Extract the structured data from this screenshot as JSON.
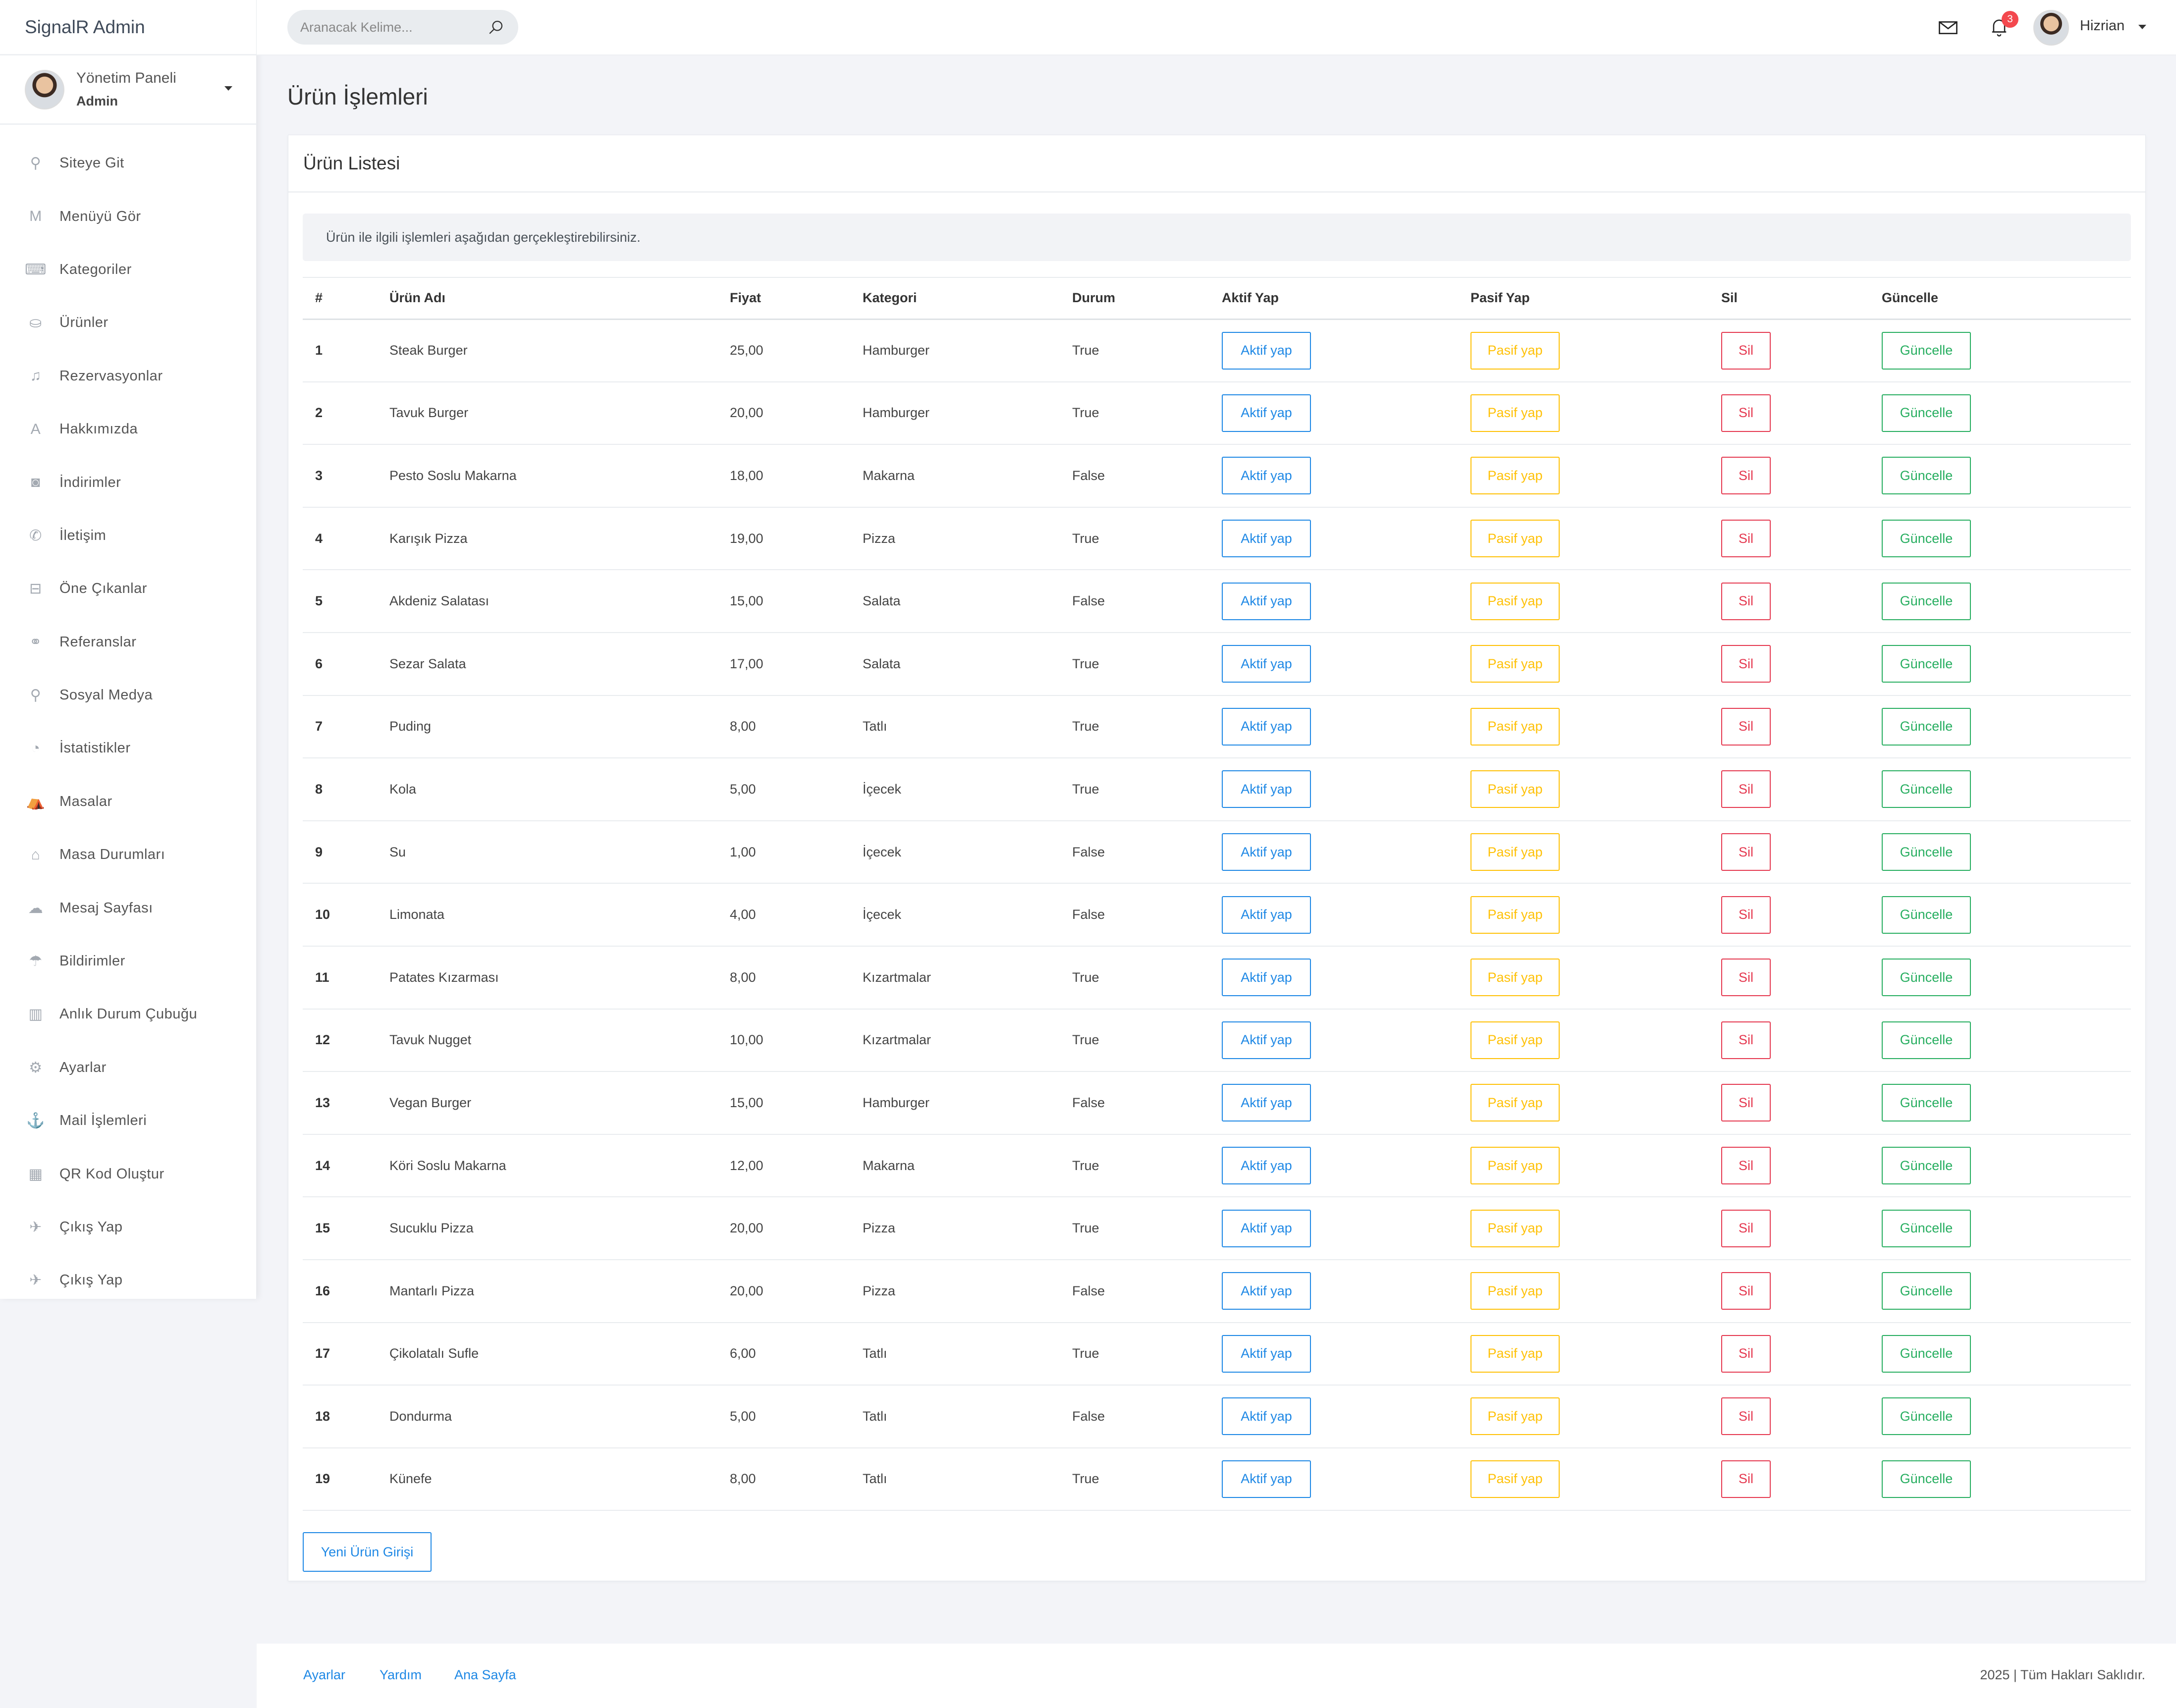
{
  "brand": "SignalR Admin",
  "profile": {
    "title": "Yönetim Paneli",
    "role": "Admin"
  },
  "menu": [
    {
      "label": "Siteye Git",
      "icon": "bicycle-icon"
    },
    {
      "label": "Menüyü Gör",
      "icon": "menu-m-icon"
    },
    {
      "label": "Kategoriler",
      "icon": "keyboard-icon"
    },
    {
      "label": "Ürünler",
      "icon": "cake-icon"
    },
    {
      "label": "Rezervasyonlar",
      "icon": "bell-icon"
    },
    {
      "label": "Hakkımızda",
      "icon": "letter-a-icon"
    },
    {
      "label": "İndirimler",
      "icon": "camera-icon"
    },
    {
      "label": "İletişim",
      "icon": "phone-icon"
    },
    {
      "label": "Öne Çıkanlar",
      "icon": "gamepad-icon"
    },
    {
      "label": "Referanslar",
      "icon": "users-icon"
    },
    {
      "label": "Sosyal Medya",
      "icon": "map-pin-icon"
    },
    {
      "label": "İstatistikler",
      "icon": "pie-chart-icon"
    },
    {
      "label": "Masalar",
      "icon": "tent-icon"
    },
    {
      "label": "Masa Durumları",
      "icon": "house-icon"
    },
    {
      "label": "Mesaj Sayfası",
      "icon": "chat-icon"
    },
    {
      "label": "Bildirimler",
      "icon": "umbrella-icon"
    },
    {
      "label": "Anlık Durum Çubuğu",
      "icon": "bar-chart-icon"
    },
    {
      "label": "Ayarlar",
      "icon": "gear-icon"
    },
    {
      "label": "Mail İşlemleri",
      "icon": "anchor-icon"
    },
    {
      "label": "QR Kod Oluştur",
      "icon": "qr-code-icon"
    },
    {
      "label": "Çıkış Yap",
      "icon": "plane-icon"
    },
    {
      "label": "Çıkış Yap",
      "icon": "plane-icon"
    }
  ],
  "search": {
    "placeholder": "Aranacak Kelime..."
  },
  "topbar": {
    "notification_count": "3",
    "username": "Hizrian"
  },
  "page": {
    "title": "Ürün İşlemleri"
  },
  "card": {
    "title": "Ürün Listesi",
    "info": "Ürün ile ilgili işlemleri aşağıdan gerçekleştirebilirsiniz.",
    "new_button": "Yeni Ürün Girişi"
  },
  "table": {
    "headers": [
      "#",
      "Ürün Adı",
      "Fiyat",
      "Kategori",
      "Durum",
      "Aktif Yap",
      "Pasif Yap",
      "Sil",
      "Güncelle"
    ],
    "button_labels": {
      "aktif": "Aktif yap",
      "pasif": "Pasif yap",
      "sil": "Sil",
      "guncelle": "Güncelle"
    },
    "rows": [
      [
        "1",
        "Steak Burger",
        "25,00",
        "Hamburger",
        "True"
      ],
      [
        "2",
        "Tavuk Burger",
        "20,00",
        "Hamburger",
        "True"
      ],
      [
        "3",
        "Pesto Soslu Makarna",
        "18,00",
        "Makarna",
        "False"
      ],
      [
        "4",
        "Karışık Pizza",
        "19,00",
        "Pizza",
        "True"
      ],
      [
        "5",
        "Akdeniz Salatası",
        "15,00",
        "Salata",
        "False"
      ],
      [
        "6",
        "Sezar Salata",
        "17,00",
        "Salata",
        "True"
      ],
      [
        "7",
        "Puding",
        "8,00",
        "Tatlı",
        "True"
      ],
      [
        "8",
        "Kola",
        "5,00",
        "İçecek",
        "True"
      ],
      [
        "9",
        "Su",
        "1,00",
        "İçecek",
        "False"
      ],
      [
        "10",
        "Limonata",
        "4,00",
        "İçecek",
        "False"
      ],
      [
        "11",
        "Patates Kızarması",
        "8,00",
        "Kızartmalar",
        "True"
      ],
      [
        "12",
        "Tavuk Nugget",
        "10,00",
        "Kızartmalar",
        "True"
      ],
      [
        "13",
        "Vegan Burger",
        "15,00",
        "Hamburger",
        "False"
      ],
      [
        "14",
        "Köri Soslu Makarna",
        "12,00",
        "Makarna",
        "True"
      ],
      [
        "15",
        "Sucuklu Pizza",
        "20,00",
        "Pizza",
        "True"
      ],
      [
        "16",
        "Mantarlı Pizza",
        "20,00",
        "Pizza",
        "False"
      ],
      [
        "17",
        "Çikolatalı Sufle",
        "6,00",
        "Tatlı",
        "True"
      ],
      [
        "18",
        "Dondurma",
        "5,00",
        "Tatlı",
        "False"
      ],
      [
        "19",
        "Künefe",
        "8,00",
        "Tatlı",
        "True"
      ]
    ]
  },
  "footer": {
    "links": [
      "Ayarlar",
      "Yardım",
      "Ana Sayfa"
    ],
    "copyright": "2025 | Tüm Hakları Saklıdır."
  }
}
